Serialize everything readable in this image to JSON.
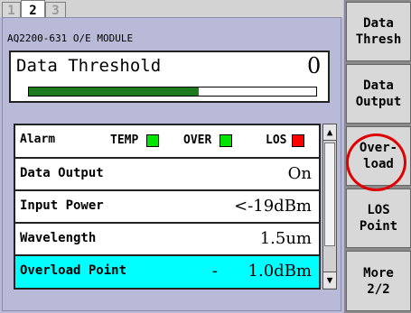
{
  "tabs": [
    {
      "label": "1",
      "active": false
    },
    {
      "label": "2",
      "active": true
    },
    {
      "label": "3",
      "active": false
    }
  ],
  "module_title": "AQ2200-631 O/E MODULE",
  "threshold": {
    "label": "Data Threshold",
    "value": "0",
    "bar_fraction": 0.59
  },
  "rows": {
    "alarm": {
      "label": "Alarm",
      "items": [
        {
          "label": "TEMP",
          "color": "#00e600"
        },
        {
          "label": "OVER",
          "color": "#00e600"
        },
        {
          "label": "LOS",
          "color": "#ff0000"
        }
      ]
    },
    "data_output": {
      "label": "Data Output",
      "value": "On"
    },
    "input_power": {
      "label": "Input Power",
      "value": "<-19dBm"
    },
    "wavelength": {
      "label": "Wavelength",
      "value": "1.5um"
    },
    "overload_point": {
      "label": "Overload Point",
      "sign": "-",
      "value": "1.0dBm"
    }
  },
  "scrollbar": {
    "up": "▲",
    "down": "▼"
  },
  "softkeys": [
    {
      "line1": "Data",
      "line2": "Thresh"
    },
    {
      "line1": "Data",
      "line2": "Output"
    },
    {
      "line1": "Over-",
      "line2": "load"
    },
    {
      "line1": "LOS",
      "line2": "Point"
    },
    {
      "line1": "More",
      "line2": "2/2"
    }
  ],
  "colors": {
    "selected_row": "#00ffff",
    "highlight_circle": "#e00000",
    "progress": "#1e7a1e"
  }
}
